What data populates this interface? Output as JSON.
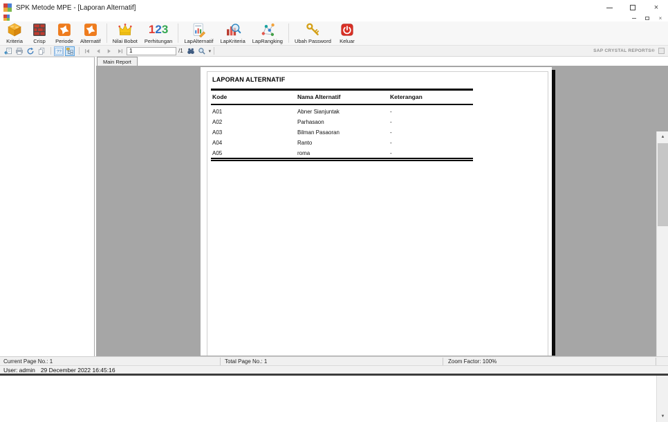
{
  "window": {
    "title": "SPK Metode MPE - [Laporan Alternatif]"
  },
  "icons": {
    "close_glyph": "×",
    "mdi_close_glyph": "×",
    "scroll_up_glyph": "▲",
    "scroll_down_glyph": "▼",
    "zoom_caret_glyph": "▾"
  },
  "toolbar": {
    "buttons": [
      {
        "label": "Kriteria",
        "icon": "brick-block-icon"
      },
      {
        "label": "Crisp",
        "icon": "brick-wall-icon"
      },
      {
        "label": "Periode",
        "icon": "orange-star-icon"
      },
      {
        "label": "Alternatif",
        "icon": "orange-star-icon"
      },
      {
        "label": "Nilai Bobot",
        "icon": "crown-icon"
      },
      {
        "label": "Perhitungan",
        "icon": "numbers-123-icon",
        "digits": [
          "1",
          "2",
          "3"
        ]
      },
      {
        "label": "LapAlternatif",
        "icon": "report-chart-pencil-icon"
      },
      {
        "label": "LapKriteria",
        "icon": "bar-chart-magnifier-icon"
      },
      {
        "label": "LapRangking",
        "icon": "network-scatter-icon"
      },
      {
        "label": "Ubah Password",
        "icon": "gold-keys-icon"
      },
      {
        "label": "Keluar",
        "icon": "power-icon"
      }
    ]
  },
  "cr_toolbar": {
    "page_value": "1",
    "page_total_label": "/1",
    "brand": "SAP CRYSTAL REPORTS®"
  },
  "tabs": {
    "main_report": "Main Report"
  },
  "report": {
    "title": "LAPORAN ALTERNATIF",
    "columns": {
      "kode": "Kode",
      "nama": "Nama Alternatif",
      "keterangan": "Keterangan"
    },
    "rows": [
      {
        "kode": "A01",
        "nama": "Abner Sianjuntak",
        "keterangan": "-"
      },
      {
        "kode": "A02",
        "nama": "Parhasaon",
        "keterangan": "-"
      },
      {
        "kode": "A03",
        "nama": "Bilman Pasaoran",
        "keterangan": "-"
      },
      {
        "kode": "A04",
        "nama": "Ranto",
        "keterangan": "-"
      },
      {
        "kode": "A05",
        "nama": "roma",
        "keterangan": "-"
      }
    ]
  },
  "status": {
    "current_page": "Current Page No.: 1",
    "total_page": "Total Page No.: 1",
    "zoom": "Zoom Factor: 100%",
    "user": "User: admin",
    "datetime": "29 December 2022 16:45:16"
  },
  "colors": {
    "accent_orange": "#ee7c1e",
    "viewer_gray": "#a6a6a6",
    "power_red": "#d93025",
    "crown_gold": "#f5c518",
    "bottom_strip": "#3c3c3c"
  }
}
